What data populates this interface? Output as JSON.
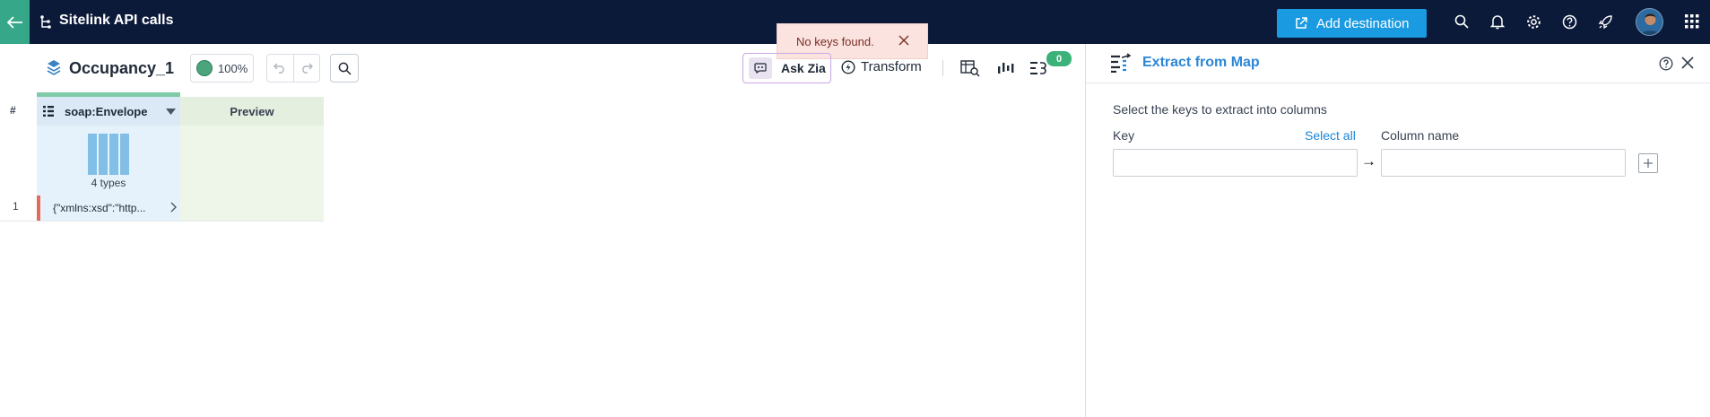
{
  "header": {
    "title": "Sitelink API calls",
    "add_destination_label": "Add destination",
    "icons": [
      "back-arrow-icon",
      "lineage-icon",
      "search-icon",
      "bell-icon",
      "gear-icon",
      "help-icon",
      "rocket-icon",
      "avatar",
      "apps-grid-icon"
    ]
  },
  "toast": {
    "message": "No keys found."
  },
  "toolbar": {
    "dataset_name": "Occupancy_1",
    "quality": "100%",
    "ask_zia": "Ask Zia",
    "transform": "Transform",
    "steps_count": "0"
  },
  "grid": {
    "row_header": "#",
    "columns": [
      {
        "name": "soap:Envelope",
        "type_summary": "4 types"
      },
      {
        "name": "Preview"
      }
    ],
    "rows": [
      {
        "num": "1",
        "value": "{\"xmlns:xsd\":\"http..."
      }
    ]
  },
  "panel": {
    "title": "Extract from Map",
    "instruction": "Select the keys to extract into columns",
    "key_label": "Key",
    "select_all": "Select all",
    "column_name_label": "Column name",
    "arrow": "→",
    "key_value": "",
    "column_value": ""
  },
  "colors": {
    "topbar": "#0c1a3a",
    "accent_green": "#36a789",
    "primary_blue": "#1a9ae0",
    "panel_title": "#2d87d6",
    "toast_bg": "#fbe4e0",
    "badge": "#3bb27a"
  }
}
